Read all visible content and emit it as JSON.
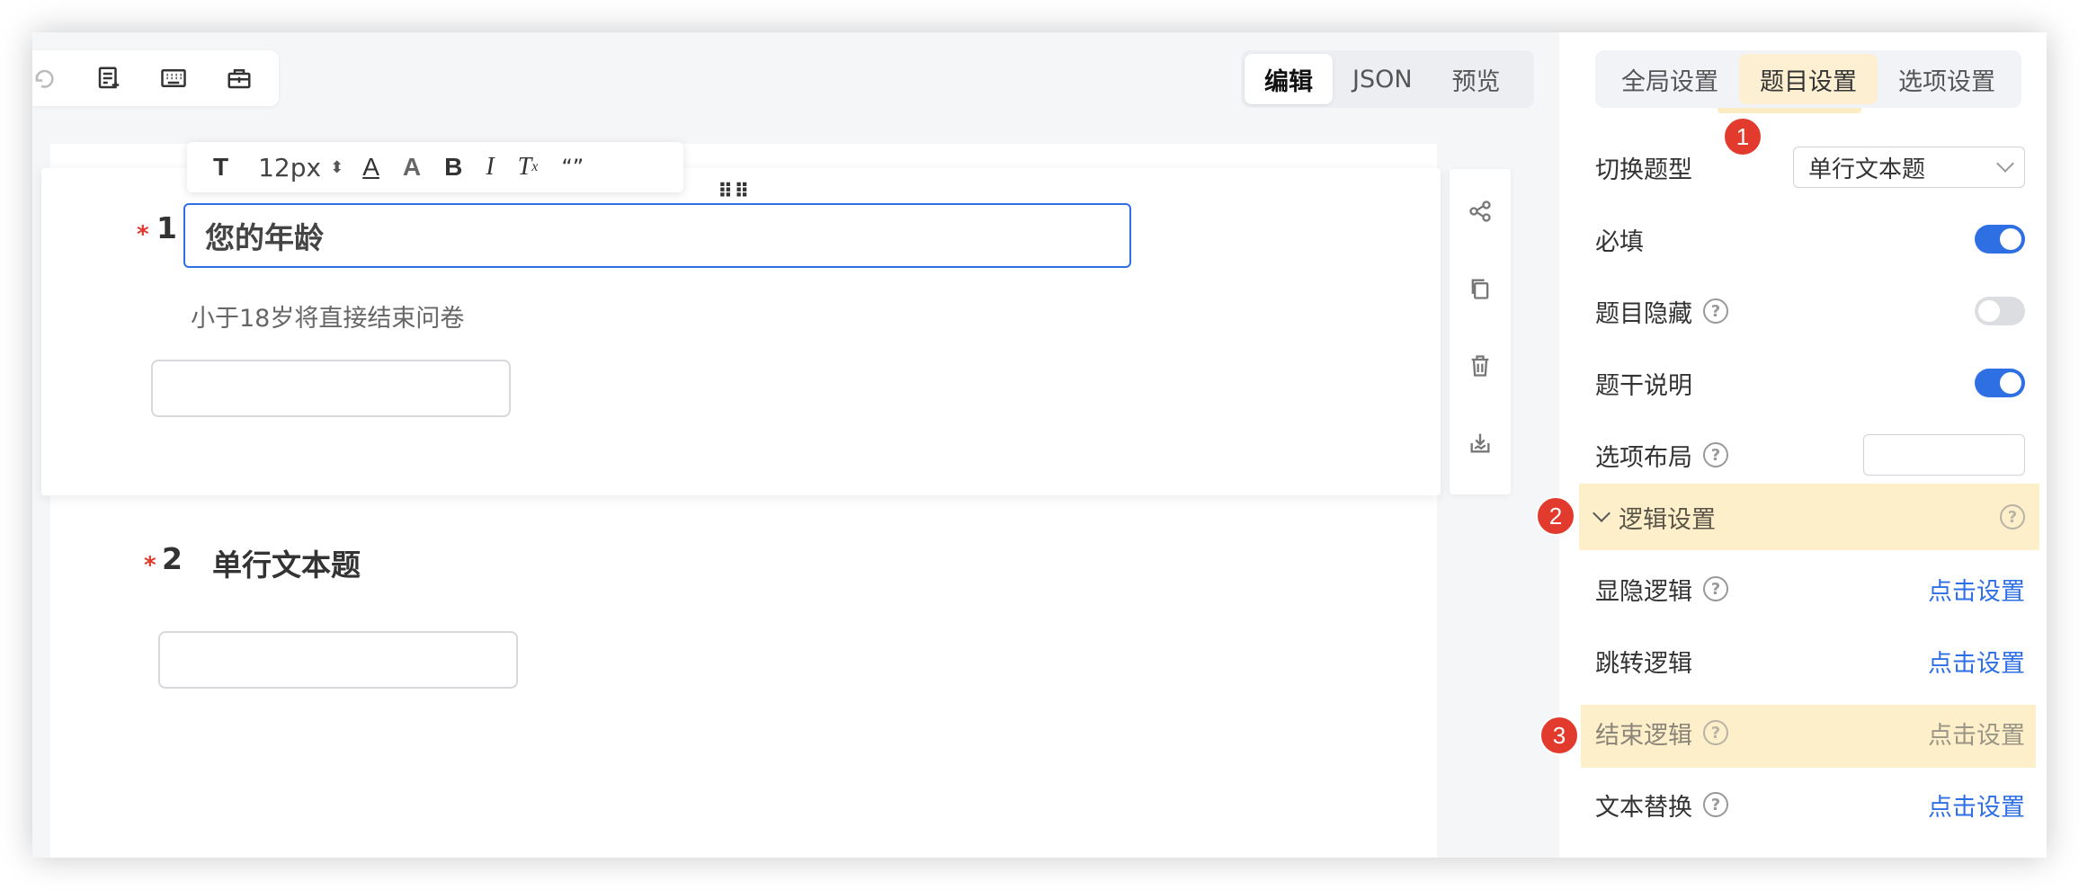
{
  "toolbar": {
    "icons": [
      "redo-icon",
      "add-note-icon",
      "keyboard-icon",
      "toolbox-icon"
    ]
  },
  "mode_tabs": [
    {
      "label": "编辑",
      "active": true
    },
    {
      "label": "JSON",
      "active": false
    },
    {
      "label": "预览",
      "active": false
    }
  ],
  "rich_toolbar": {
    "font_size": "12px",
    "buttons": [
      "text-format-icon",
      "font-color-icon",
      "background-color-icon",
      "bold-icon",
      "italic-icon",
      "clear-format-icon",
      "quote-icon"
    ]
  },
  "questions": [
    {
      "required_mark": "*",
      "number": "1",
      "title": "您的年龄",
      "description": "小于18岁将直接结束问卷"
    },
    {
      "required_mark": "*",
      "number": "2",
      "title": "单行文本题"
    }
  ],
  "panel": {
    "tabs": [
      {
        "label": "全局设置",
        "active": false
      },
      {
        "label": "题目设置",
        "active": true
      },
      {
        "label": "选项设置",
        "active": false
      }
    ],
    "question_type": {
      "label": "切换题型",
      "value": "单行文本题"
    },
    "required": {
      "label": "必填",
      "on": true
    },
    "hidden": {
      "label": "题目隐藏",
      "on": false
    },
    "stem_desc": {
      "label": "题干说明",
      "on": true
    },
    "option_layout": {
      "label": "选项布局",
      "value": ""
    },
    "logic_section": {
      "title": "逻辑设置"
    },
    "logic_rows": [
      {
        "label": "显隐逻辑",
        "link": "点击设置",
        "help": true
      },
      {
        "label": "跳转逻辑",
        "link": "点击设置",
        "help": false
      },
      {
        "label": "结束逻辑",
        "link": "点击设置",
        "help": true
      },
      {
        "label": "文本替换",
        "link": "点击设置",
        "help": true
      }
    ]
  },
  "annotations": [
    "1",
    "2",
    "3"
  ],
  "colors": {
    "accent": "#2f6fe4",
    "highlight": "#fdefc9",
    "badge": "#e23b2e"
  }
}
